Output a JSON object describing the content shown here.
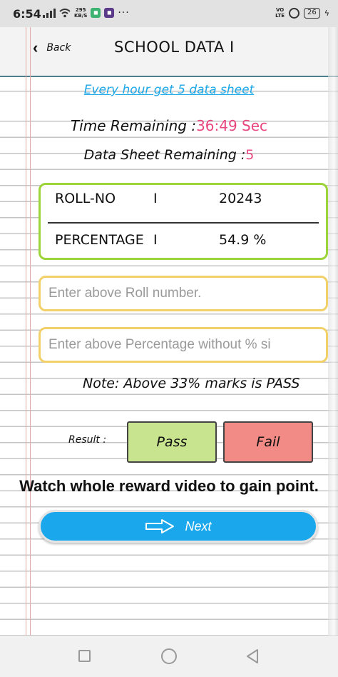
{
  "status_bar": {
    "time": "6:54",
    "speed_value": "295",
    "speed_unit": "KB/S",
    "volte_top": "VO",
    "volte_bottom": "LTE",
    "battery": "26"
  },
  "header": {
    "back_label": "Back",
    "title": "SCHOOL DATA I"
  },
  "info": {
    "every_hour": "Every hour get 5 data sheet",
    "time_label": "Time Remaining :",
    "time_value": "36:49 Sec",
    "sheet_label": "Data Sheet Remaining :",
    "sheet_value": "5"
  },
  "record": {
    "roll_label": "ROLL-NO",
    "roll_sep": "I",
    "roll_value": "20243",
    "pct_label": "PERCENTAGE",
    "pct_sep": "I",
    "pct_value": "54.9 %"
  },
  "inputs": {
    "roll_placeholder": "Enter above Roll number.",
    "pct_placeholder": "Enter above Percentage without % si"
  },
  "note": "Note: Above 33% marks is PASS",
  "result": {
    "label": "Result :",
    "pass_label": "Pass",
    "fail_label": "Fail"
  },
  "reward_text": "Watch whole reward video to gain point.",
  "next_label": "Next",
  "colors": {
    "accent_blue": "#1aa7ec",
    "pink": "#e8467f",
    "card_border": "#9dd43a",
    "input_border": "#f2d06a",
    "pass_bg": "#c8e48f",
    "fail_bg": "#f28b85"
  }
}
